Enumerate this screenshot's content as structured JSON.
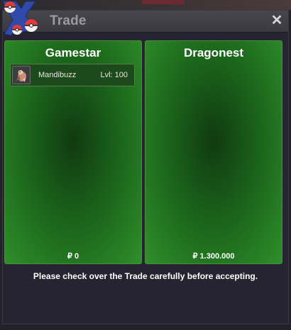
{
  "window": {
    "title": "Trade",
    "close_label": "✕"
  },
  "left_panel": {
    "name": "Gamestar",
    "items": [
      {
        "name": "Mandibuzz",
        "level": "Lvl: 100",
        "icon": "mandibuzz-icon"
      }
    ],
    "money": "₽ 0"
  },
  "right_panel": {
    "name": "Dragonest",
    "items": [],
    "money": "₽ 1.300.000"
  },
  "notice": "Please check over the Trade carefully before accepting.",
  "colors": {
    "panel_green": "#1d6a1d",
    "titlebar": "#434249",
    "background": "#252430"
  }
}
